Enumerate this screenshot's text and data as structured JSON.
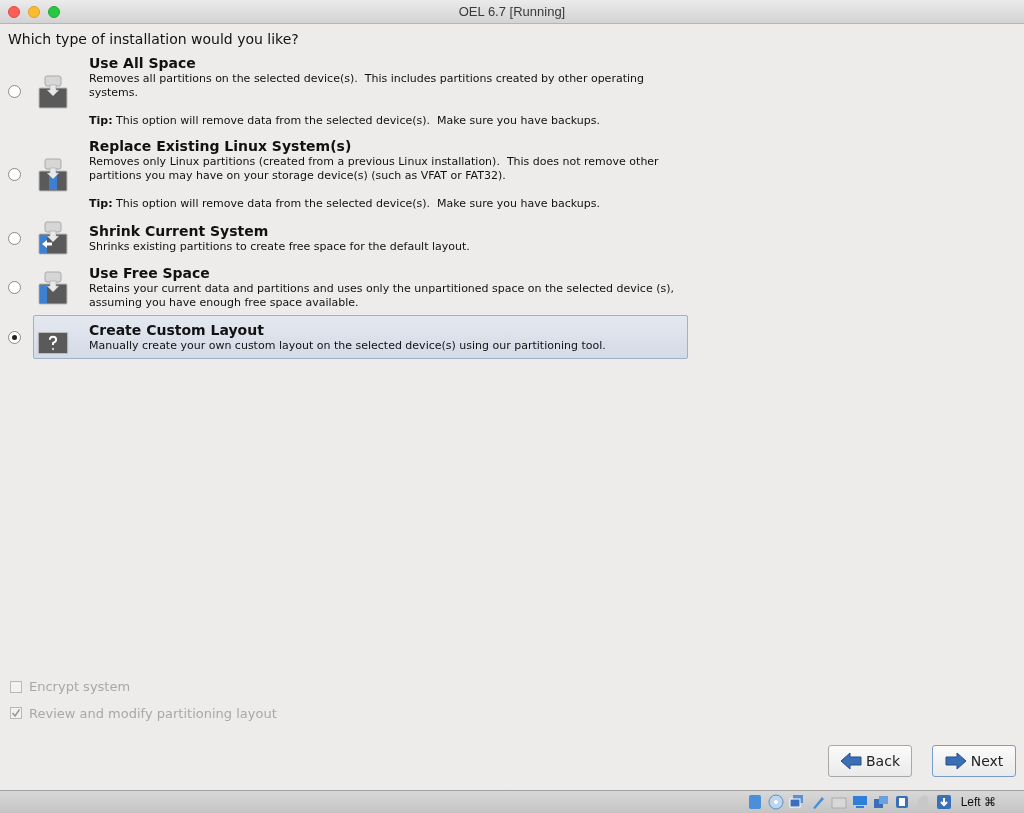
{
  "window": {
    "title": "OEL 6.7 [Running]"
  },
  "question": "Which type of installation would you like?",
  "options": [
    {
      "kind": "erase",
      "title": "Use All Space",
      "description": "Removes all partitions on the selected device(s).  This includes partitions created by other operating systems.",
      "tip": "**Tip:** This option will remove data from the selected device(s).  Make sure you have backups.",
      "selected": false
    },
    {
      "kind": "replace",
      "title": "Replace Existing Linux System(s)",
      "description": "Removes only Linux partitions (created from a previous Linux installation).  This does not remove other partitions you may have on your storage device(s) (such as VFAT or FAT32).",
      "tip": "**Tip:** This option will remove data from the selected device(s).  Make sure you have backups.",
      "selected": false
    },
    {
      "kind": "shrink",
      "title": "Shrink Current System",
      "description": "Shrinks existing partitions to create free space for the default layout.",
      "selected": false
    },
    {
      "kind": "free",
      "title": "Use Free Space",
      "description": "Retains your current data and partitions and uses only the unpartitioned space on the selected device (s), assuming you have enough free space available.",
      "selected": false
    },
    {
      "kind": "custom",
      "title": "Create Custom Layout",
      "description": "Manually create your own custom layout on the selected device(s) using our partitioning tool.",
      "selected": true
    }
  ],
  "checkboxes": [
    {
      "label": "Encrypt system",
      "checked": false,
      "disabled": true
    },
    {
      "label": "Review and modify partitioning layout",
      "checked": true,
      "disabled": true
    }
  ],
  "buttons": [
    {
      "kind": "back",
      "label": "Back",
      "focused": false
    },
    {
      "kind": "next",
      "label": "Next",
      "focused": true
    }
  ],
  "status_bar": {
    "host_key": "Left ⌘"
  }
}
